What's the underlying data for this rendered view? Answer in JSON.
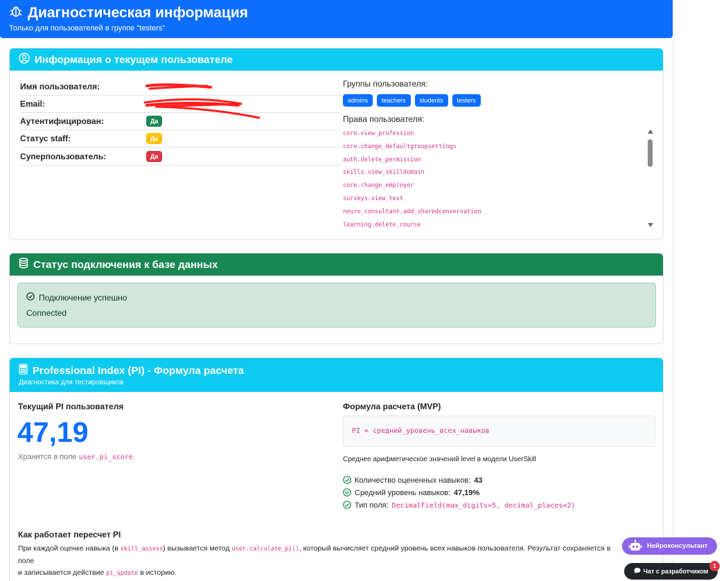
{
  "header": {
    "title": "Диагностическая информация",
    "subtitle": "Только для пользователей в группе \"testers\"",
    "icon": "bug-icon"
  },
  "user_card": {
    "title": "Информация о текущем пользователе",
    "icon": "person-circle-icon",
    "rows": {
      "username": {
        "label": "Имя пользователя:"
      },
      "email": {
        "label": "Email:"
      },
      "authenticated": {
        "label": "Аутентифицирован:",
        "value": "Да",
        "color": "#198754"
      },
      "staff": {
        "label": "Статус staff:",
        "value": "Да",
        "color": "#ffc107"
      },
      "superuser": {
        "label": "Суперпользователь:",
        "value": "Да",
        "color": "#dc3545"
      }
    },
    "groups_title": "Группы пользователя:",
    "groups": [
      "admins",
      "teachers",
      "students",
      "testers"
    ],
    "permissions_title": "Права пользователя:",
    "permissions": [
      "core.view_profession",
      "core.change_defaultgroupsettings",
      "auth.delete_permission",
      "skills.view_skilldomain",
      "core.change_employer",
      "surveys.view_test",
      "neuro_consultant.add_sharedconversation",
      "learning.delete_course"
    ]
  },
  "db_card": {
    "title": "Статус подключения к базе данных",
    "icon": "database-icon",
    "alert_title": "Подключение успешно",
    "alert_text": "Connected",
    "color": "#198754"
  },
  "pi_card": {
    "title": "Professional Index (PI) - Формула расчета",
    "subtitle": "Диагностика для тестировщиков",
    "icon": "calculator-icon",
    "current_label": "Текущий PI пользователя",
    "current_value": "47,19",
    "stored_prefix": "Хранится в поле",
    "stored_field": "user.pi_score",
    "formula_title": "Формула расчета (MVP)",
    "formula": "PI = средний_уровень_всех_навыков",
    "formula_desc": "Среднее арифметическое значений level в модели UserSkill",
    "checks": {
      "count_label": "Количество оцененных навыков:",
      "count_value": "43",
      "avg_label": "Средний уровень навыков:",
      "avg_value": "47,19%",
      "type_label": "Тип поля:",
      "type_value": "DecimalField(max_digits=5, decimal_places=2)"
    },
    "how_title": "Как работает пересчет PI",
    "how": {
      "p1": "При каждой оценке навыка (в",
      "c1": "skill_assess",
      "p2": ") вызывается метод",
      "c2": "user.calculate_pi()",
      "p3": ", который вычисляет средний уровень всех навыков пользователя. Результат сохраняется в поле",
      "p4": "и записывается действие",
      "c3": "pi_update",
      "p5": "в историю."
    }
  },
  "floating": {
    "ai_label": "Нейроконсультант",
    "dev_chat_label": "Чат с разработчиком",
    "dev_badge": "1"
  }
}
